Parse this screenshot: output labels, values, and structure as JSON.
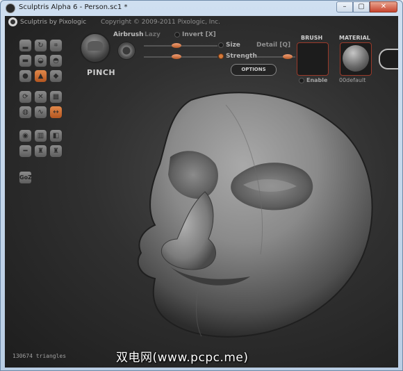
{
  "window": {
    "title": "Sculptris Alpha 6 - Person.sc1 *",
    "controls": [
      "–",
      "▢",
      "✕"
    ]
  },
  "header": {
    "app_name": "Sculptris by Pixologic",
    "copyright": "Copyright © 2009-2011 Pixologic, Inc."
  },
  "toolbar": {
    "buttons": [
      {
        "icon": "draw-icon",
        "active": false
      },
      {
        "icon": "rotate-icon",
        "active": false
      },
      {
        "icon": "crop-icon",
        "active": false
      },
      {
        "icon": "flatten-icon",
        "active": false
      },
      {
        "icon": "inflate-icon",
        "active": false
      },
      {
        "icon": "smooth-icon",
        "active": false
      },
      {
        "icon": "person-icon",
        "active": false
      },
      {
        "icon": "pinch-icon",
        "active": true
      },
      {
        "icon": "grab-icon",
        "active": false
      },
      {
        "icon": "refresh-icon",
        "active": false
      },
      {
        "icon": "cross-icon",
        "active": false
      },
      {
        "icon": "grid-icon",
        "active": false
      },
      {
        "icon": "mask-icon",
        "active": false
      },
      {
        "icon": "wave-icon",
        "active": false
      },
      {
        "icon": "symmetry-icon",
        "active": true
      },
      {
        "icon": "sphere-icon",
        "active": false
      },
      {
        "icon": "paint-icon",
        "active": false
      },
      {
        "icon": "bucket-icon",
        "active": false
      },
      {
        "icon": "minus-icon",
        "active": false
      },
      {
        "icon": "figure-icon",
        "active": false
      },
      {
        "icon": "figure2-icon",
        "active": false
      }
    ],
    "goz_label": "GoZ"
  },
  "brush": {
    "name": "PINCH",
    "airbrush_label": "Airbrush",
    "lazy_label": "Lazy",
    "invert_label": "Invert [X]",
    "size_label": "Size",
    "strength_label": "Strength",
    "detail_label": "Detail [Q]",
    "options_label": "OPTIONS"
  },
  "panels": {
    "brush_header": "BRUSH",
    "enable_label": "Enable",
    "material_header": "MATERIAL",
    "material_name": "00default"
  },
  "status": {
    "triangles": "130674 triangles"
  },
  "watermark": "双电网(www.pcpc.me)",
  "colors": {
    "accent": "#d47a3b",
    "border_accent": "#9b3a2a"
  }
}
